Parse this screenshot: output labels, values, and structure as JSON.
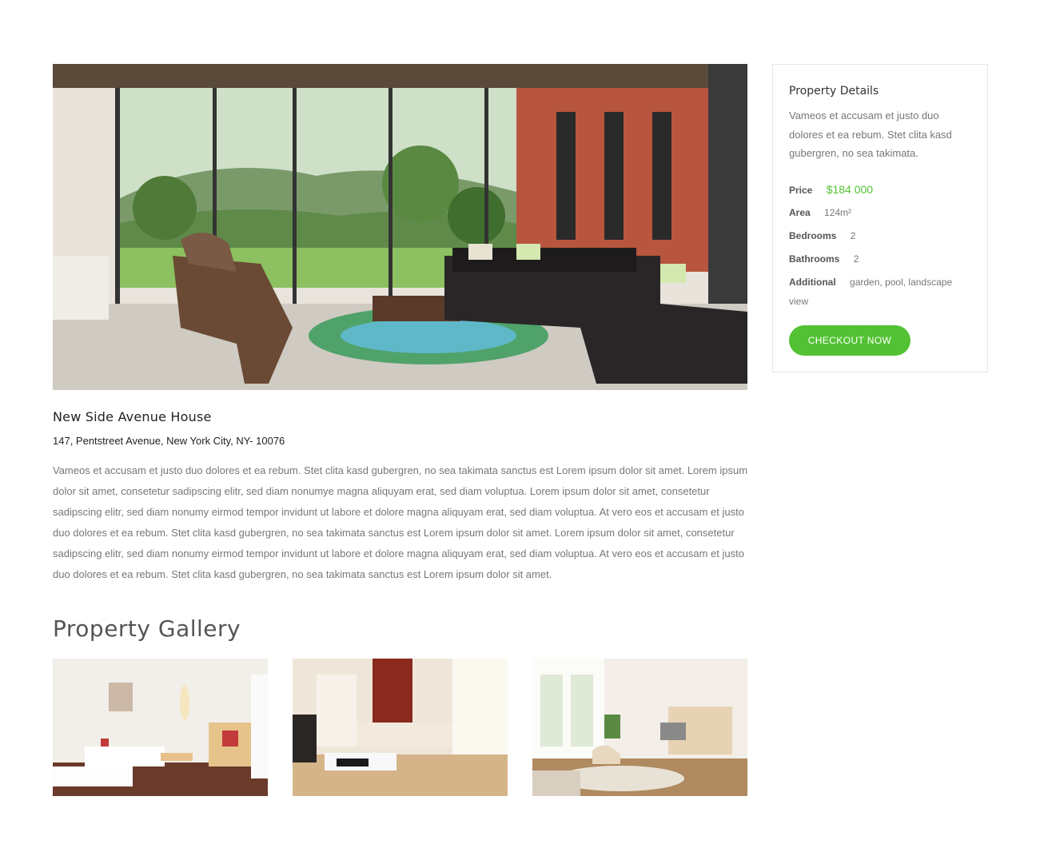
{
  "property": {
    "title": "New Side Avenue House",
    "address": "147, Pentstreet Avenue, New York City, NY- 10076",
    "description": "Vameos et accusam et justo duo dolores et ea rebum. Stet clita kasd gubergren, no sea takimata sanctus est Lorem ipsum dolor sit amet. Lorem ipsum dolor sit amet, consetetur sadipscing elitr, sed diam nonumye magna aliquyam erat, sed diam voluptua. Lorem ipsum dolor sit amet, consetetur sadipscing elitr, sed diam nonumy eirmod tempor invidunt ut labore et dolore magna aliquyam erat, sed diam voluptua. At vero eos et accusam et justo duo dolores et ea rebum. Stet clita kasd gubergren, no sea takimata sanctus est Lorem ipsum dolor sit amet. Lorem ipsum dolor sit amet, consetetur sadipscing elitr, sed diam nonumy eirmod tempor invidunt ut labore et dolore magna aliquyam erat, sed diam voluptua. At vero eos et accusam et justo duo dolores et ea rebum. Stet clita kasd gubergren, no sea takimata sanctus est Lorem ipsum dolor sit amet."
  },
  "gallery": {
    "title": "Property Gallery"
  },
  "details": {
    "title": "Property Details",
    "description": "Vameos et accusam et justo duo dolores et ea rebum. Stet clita kasd gubergren, no sea takimata.",
    "specs": {
      "price_label": "Price",
      "price_value": "$184 000",
      "area_label": "Area",
      "area_value": "124m²",
      "bedrooms_label": "Bedrooms",
      "bedrooms_value": "2",
      "bathrooms_label": "Bathrooms",
      "bathrooms_value": "2",
      "additional_label": "Additional",
      "additional_value": "garden, pool, landscape view"
    },
    "checkout_label": "CHECKOUT NOW"
  },
  "colors": {
    "accent": "#52c234",
    "heading": "#222222",
    "body_text": "#777777"
  }
}
